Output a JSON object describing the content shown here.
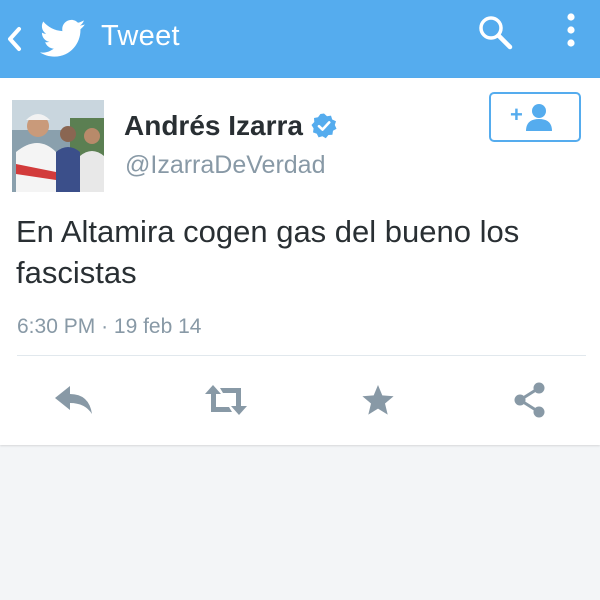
{
  "appbar": {
    "title": "Tweet",
    "icons": [
      "back-icon",
      "twitter-bird-icon",
      "search-icon",
      "overflow-menu-icon"
    ]
  },
  "tweet": {
    "author_name": "Andrés Izarra",
    "author_handle": "@IzarraDeVerdad",
    "verified": true,
    "text": "En Altamira cogen gas del bueno los fascistas",
    "time": "6:30 PM",
    "separator": "·",
    "date": "19 feb 14"
  },
  "follow_button": {
    "icon": "add-user-icon",
    "symbol": "+"
  },
  "actions": [
    "reply-icon",
    "retweet-icon",
    "favorite-star-icon",
    "share-icon"
  ],
  "colors": {
    "brand": "#55acee",
    "icon_gray": "#8899a6",
    "text": "#292f33",
    "background": "#f3f5f7"
  }
}
